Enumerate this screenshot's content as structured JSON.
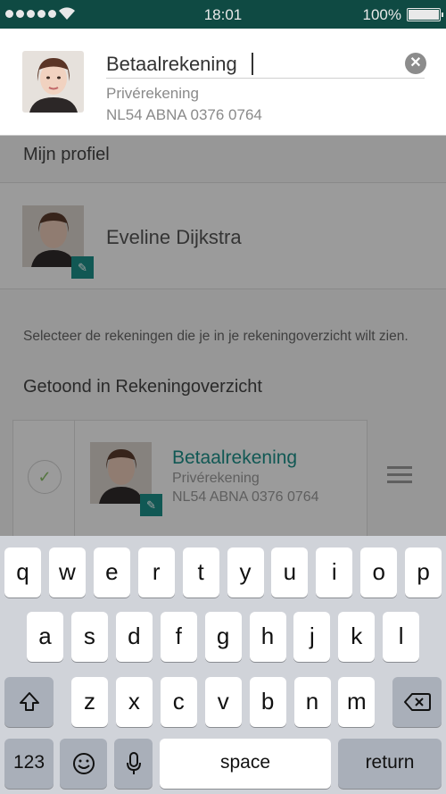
{
  "status_bar": {
    "time": "18:01",
    "battery": "100%",
    "battery_level": 1.0
  },
  "edit_header": {
    "account_name_value": "Betaalrekening",
    "account_type": "Privérekening",
    "iban": "NL54 ABNA 0376 0764",
    "clear_icon": "close-circle-icon"
  },
  "profile": {
    "section_title": "Mijn profiel",
    "name": "Eveline Dijkstra",
    "edit_icon": "pencil-icon"
  },
  "accounts": {
    "hint": "Selecteer de rekeningen die je in je rekeningoverzicht wilt zien.",
    "section_title": "Getoond in Rekeningoverzicht",
    "items": [
      {
        "name": "Betaalrekening",
        "type": "Privérekening",
        "iban": "NL54 ABNA 0376 0764",
        "selected": true
      }
    ]
  },
  "keyboard": {
    "row1": [
      "q",
      "w",
      "e",
      "r",
      "t",
      "y",
      "u",
      "i",
      "o",
      "p"
    ],
    "row2": [
      "a",
      "s",
      "d",
      "f",
      "g",
      "h",
      "j",
      "k",
      "l"
    ],
    "row3": [
      "z",
      "x",
      "c",
      "v",
      "b",
      "n",
      "m"
    ],
    "numbers_label": "123",
    "space_label": "space",
    "return_label": "return",
    "shift_icon": "shift-icon",
    "delete_icon": "backspace-icon",
    "emoji_icon": "emoji-icon",
    "mic_icon": "microphone-icon"
  },
  "colors": {
    "status_bar": "#0f4a43",
    "accent": "#1c8f88"
  }
}
